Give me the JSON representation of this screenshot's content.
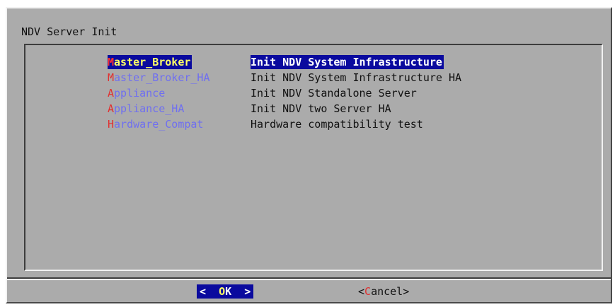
{
  "dialog": {
    "title": "NDV Server Init"
  },
  "menu": {
    "items": [
      {
        "tag_hotkey": "M",
        "tag_rest": "aster_Broker",
        "description": "Init NDV System Infrastructure",
        "selected": true
      },
      {
        "tag_hotkey": "M",
        "tag_rest": "aster_Broker_HA",
        "description": "Init NDV System Infrastructure HA",
        "selected": false
      },
      {
        "tag_hotkey": "A",
        "tag_rest": "ppliance",
        "description": "Init NDV Standalone Server",
        "selected": false
      },
      {
        "tag_hotkey": "A",
        "tag_rest": "ppliance_HA",
        "description": "Init NDV two Server HA",
        "selected": false
      },
      {
        "tag_hotkey": "H",
        "tag_rest": "ardware_Compat",
        "description": "Hardware compatibility test",
        "selected": false
      }
    ]
  },
  "buttons": {
    "ok": {
      "left": "<  ",
      "hotkey": "O",
      "rest": "K",
      "right": "  >"
    },
    "cancel": {
      "left": "<",
      "hotkey": "C",
      "rest": "ancel",
      "right": ">"
    }
  },
  "colors": {
    "dialog_background": "#ababab",
    "selection_background": "#0a0a9e",
    "selected_tag_text": "#ffff66",
    "hotkey": "#e03030",
    "tag_text": "#6f6ff0",
    "normal_text": "#111111"
  }
}
